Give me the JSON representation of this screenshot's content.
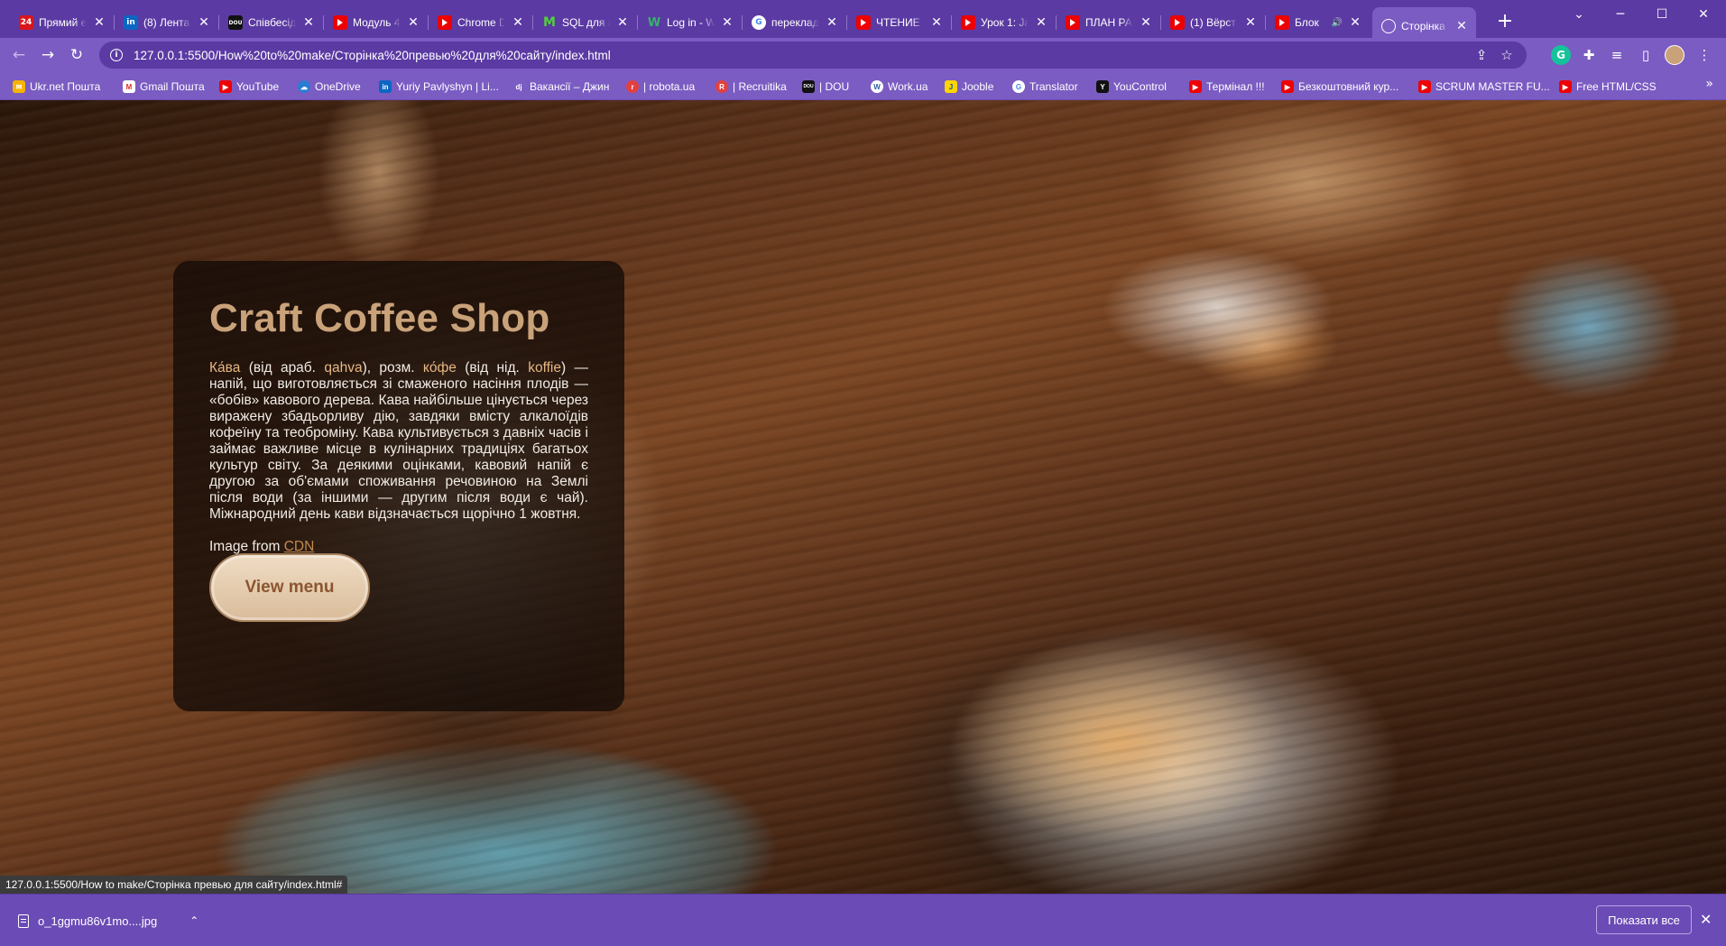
{
  "browser": {
    "tabs": [
      {
        "title": "Прямий е",
        "favicon": "24-icon",
        "favtext": "24"
      },
      {
        "title": "(8) Лента",
        "favicon": "linkedin-icon",
        "favtext": "in"
      },
      {
        "title": "Співбесід",
        "favicon": "dou-icon",
        "favtext": "DOU"
      },
      {
        "title": "Модуль 4",
        "favicon": "youtube-icon",
        "favtext": ""
      },
      {
        "title": "Chrome D",
        "favicon": "youtube-icon",
        "favtext": ""
      },
      {
        "title": "SQL для а",
        "favicon": "m-icon",
        "favtext": "M"
      },
      {
        "title": "Log in - W",
        "favicon": "w-icon",
        "favtext": "W"
      },
      {
        "title": "переклад",
        "favicon": "google-icon",
        "favtext": "G"
      },
      {
        "title": "ЧТЕНИЕ Н",
        "favicon": "youtube-icon",
        "favtext": ""
      },
      {
        "title": "Урок 1: Ja",
        "favicon": "youtube-icon",
        "favtext": ""
      },
      {
        "title": "ПЛАН РА",
        "favicon": "youtube-icon",
        "favtext": ""
      },
      {
        "title": "(1) Вёрст",
        "favicon": "youtube-icon",
        "favtext": ""
      },
      {
        "title": "Блок",
        "favicon": "youtube-icon",
        "favtext": ""
      },
      {
        "title": "Сторінка",
        "favicon": "globe-icon",
        "favtext": ""
      }
    ],
    "url": "127.0.0.1:5500/How%20to%20make/Сторінка%20превью%20для%20сайту/index.html",
    "bookmarks": [
      {
        "label": "Ukr.net Пошта",
        "icon": "ukrnet-icon"
      },
      {
        "label": "Gmail Пошта",
        "icon": "gmail-icon"
      },
      {
        "label": "YouTube",
        "icon": "youtube-icon"
      },
      {
        "label": "OneDrive",
        "icon": "onedrive-icon"
      },
      {
        "label": "Yuriy Pavlyshyn | Li...",
        "icon": "linkedin-icon"
      },
      {
        "label": "Вакансії – Джин",
        "icon": "djinni-icon"
      },
      {
        "label": "| robota.ua",
        "icon": "robota-icon"
      },
      {
        "label": "| Recruitika",
        "icon": "recruitika-icon"
      },
      {
        "label": "| DOU",
        "icon": "dou-icon"
      },
      {
        "label": "Work.ua",
        "icon": "workua-icon"
      },
      {
        "label": "Jooble",
        "icon": "jooble-icon"
      },
      {
        "label": "Translator",
        "icon": "google-icon"
      },
      {
        "label": "YouControl",
        "icon": "youcontrol-icon"
      },
      {
        "label": "Термінал !!!",
        "icon": "youtube-icon"
      },
      {
        "label": "Безкоштовний кур...",
        "icon": "youtube-icon"
      },
      {
        "label": "SCRUM MASTER FU...",
        "icon": "youtube-icon"
      },
      {
        "label": "Free HTML/CSS",
        "icon": "youtube-icon"
      }
    ],
    "more_bookmarks": "»",
    "status_url": "127.0.0.1:5500/How to make/Сторінка превью для сайту/index.html#"
  },
  "page": {
    "title": "Craft Coffee Shop",
    "description": {
      "word1": "Ка́ва",
      "part1": " (від араб. ",
      "word2": "qahva",
      "part2": "), розм. ",
      "word3": "ко́фе",
      "part3": " (від нід. ",
      "word4": "koffie",
      "part4": ") — напій, що виготовляється зі смаженого насіння плодів — «бобів» кавового дерева. Кава найбільше цінується через виражену збадьорливу дію, завдяки вмісту алкалоїдів кофеїну та теоброміну. Кава культивується з давніх часів і займає важливе місце в кулінарних традиціях багатьох культур світу. За деякими оцінками, кавовий напій є другою за об'ємами споживання речовиною на Землі після води (за іншими — другим після води є чай). Міжнародний день кави відзначається щорічно 1 жовтня."
    },
    "credit_prefix": "Image from ",
    "credit_link": "CDN",
    "button_label": "View menu",
    "colors": {
      "title": "#c9a27a",
      "link": "#c38a4f",
      "button_bg": "#e6ceb2"
    }
  },
  "downloads": {
    "file_name": "o_1ggmu86v1mo....jpg",
    "show_all": "Показати все"
  }
}
